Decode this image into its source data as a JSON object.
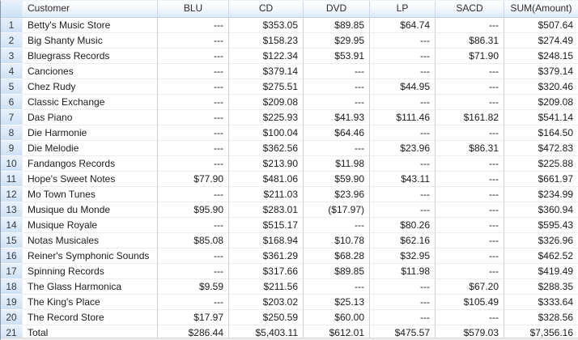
{
  "table": {
    "corner_label": "",
    "columns": [
      "Customer",
      "BLU",
      "CD",
      "DVD",
      "LP",
      "SACD",
      "SUM(Amount)"
    ],
    "empty_value": "---",
    "rows": [
      [
        "1",
        "Betty's Music Store",
        "---",
        "$353.05",
        "$89.85",
        "$64.74",
        "---",
        "$507.64"
      ],
      [
        "2",
        "Big Shanty Music",
        "---",
        "$158.23",
        "$29.95",
        "---",
        "$86.31",
        "$274.49"
      ],
      [
        "3",
        "Bluegrass Records",
        "---",
        "$122.34",
        "$53.91",
        "---",
        "$71.90",
        "$248.15"
      ],
      [
        "4",
        "Canciones",
        "---",
        "$379.14",
        "---",
        "---",
        "---",
        "$379.14"
      ],
      [
        "5",
        "Chez Rudy",
        "---",
        "$275.51",
        "---",
        "$44.95",
        "---",
        "$320.46"
      ],
      [
        "6",
        "Classic Exchange",
        "---",
        "$209.08",
        "---",
        "---",
        "---",
        "$209.08"
      ],
      [
        "7",
        "Das Piano",
        "---",
        "$225.93",
        "$41.93",
        "$111.46",
        "$161.82",
        "$541.14"
      ],
      [
        "8",
        "Die Harmonie",
        "---",
        "$100.04",
        "$64.46",
        "---",
        "---",
        "$164.50"
      ],
      [
        "9",
        "Die Melodie",
        "---",
        "$362.56",
        "---",
        "$23.96",
        "$86.31",
        "$472.83"
      ],
      [
        "10",
        "Fandangos Records",
        "---",
        "$213.90",
        "$11.98",
        "---",
        "---",
        "$225.88"
      ],
      [
        "11",
        "Hope's Sweet Notes",
        "$77.90",
        "$481.06",
        "$59.90",
        "$43.11",
        "---",
        "$661.97"
      ],
      [
        "12",
        "Mo Town Tunes",
        "---",
        "$211.03",
        "$23.96",
        "---",
        "---",
        "$234.99"
      ],
      [
        "13",
        "Musique du Monde",
        "$95.90",
        "$283.01",
        "($17.97)",
        "---",
        "---",
        "$360.94"
      ],
      [
        "14",
        "Musique Royale",
        "---",
        "$515.17",
        "---",
        "$80.26",
        "---",
        "$595.43"
      ],
      [
        "15",
        "Notas Musicales",
        "$85.08",
        "$168.94",
        "$10.78",
        "$62.16",
        "---",
        "$326.96"
      ],
      [
        "16",
        "Reiner's Symphonic Sounds",
        "---",
        "$361.29",
        "$68.28",
        "$32.95",
        "---",
        "$462.52"
      ],
      [
        "17",
        "Spinning Records",
        "---",
        "$317.66",
        "$89.85",
        "$11.98",
        "---",
        "$419.49"
      ],
      [
        "18",
        "The Glass Harmonica",
        "$9.59",
        "$211.56",
        "---",
        "---",
        "$67.20",
        "$288.35"
      ],
      [
        "19",
        "The King's Place",
        "---",
        "$203.02",
        "$25.13",
        "---",
        "$105.49",
        "$333.64"
      ],
      [
        "20",
        "The Record Store",
        "$17.97",
        "$250.59",
        "$60.00",
        "---",
        "---",
        "$328.56"
      ],
      [
        "21",
        "Total",
        "$286.44",
        "$5,403.11",
        "$612.01",
        "$475.57",
        "$579.03",
        "$7,356.16"
      ]
    ]
  },
  "colors": {
    "header_gradient_top": "#ffffff",
    "header_gradient_bottom": "#dce9f8",
    "header_border": "#c2d3e8",
    "row_number_top": "#e7effa",
    "row_number_bottom": "#cde0f4",
    "grid_line_vertical": "#cdcdcd",
    "grid_line_horizontal": "#ececec",
    "left_edge": "#8696ab",
    "text": "#1b1b1b"
  }
}
